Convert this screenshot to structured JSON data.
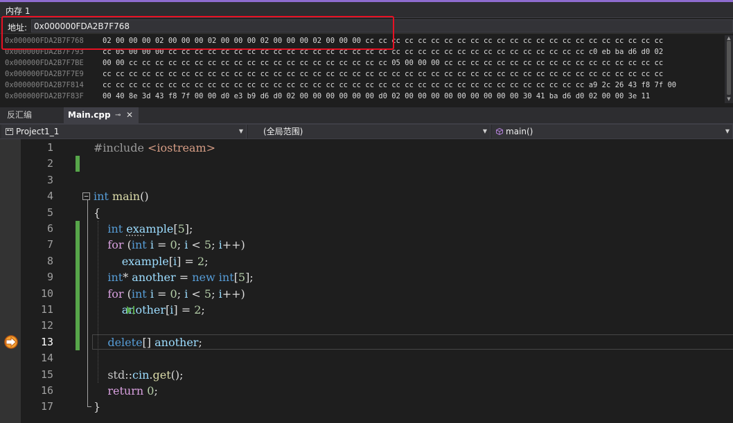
{
  "memory_window": {
    "title": "内存 1",
    "address_label": "地址:",
    "address_value": "0x000000FDA2B7F768",
    "rows": [
      {
        "address": "0x000000FDA2B7F768",
        "bytes": "02 00 00 00 02 00 00 00 02 00 00 00 02 00 00 00 02 00 00 00 cc cc cc cc cc cc cc cc cc cc cc cc cc cc cc cc cc cc cc cc cc cc cc"
      },
      {
        "address": "0x000000FDA2B7F793",
        "bytes": "cc 05 00 00 00 cc cc cc cc cc cc cc cc cc cc cc cc cc cc cc cc cc cc cc cc cc cc cc cc cc cc cc cc cc cc cc cc c0 eb ba d6 d0 02"
      },
      {
        "address": "0x000000FDA2B7F7BE",
        "bytes": "00 00 cc cc cc cc cc cc cc cc cc cc cc cc cc cc cc cc cc cc cc cc 05 00 00 00 cc cc cc cc cc cc cc cc cc cc cc cc cc cc cc cc cc"
      },
      {
        "address": "0x000000FDA2B7F7E9",
        "bytes": "cc cc cc cc cc cc cc cc cc cc cc cc cc cc cc cc cc cc cc cc cc cc cc cc cc cc cc cc cc cc cc cc cc cc cc cc cc cc cc cc cc cc cc"
      },
      {
        "address": "0x000000FDA2B7F814",
        "bytes": "cc cc cc cc cc cc cc cc cc cc cc cc cc cc cc cc cc cc cc cc cc cc cc cc cc cc cc cc cc cc cc cc cc cc cc cc cc a9 2c 26 43 f8 7f 00"
      },
      {
        "address": "0x000000FDA2B7F83F",
        "bytes": "00 40 8e 3d 43 f8 7f 00 00 d0 e3 b9 d6 d0 02 00 00 00 00 00 00 d0 02 00 00 00 00 00 00 00 00 00 30 41 ba d6 d0 02 00 00 3e 11"
      }
    ]
  },
  "tabs": [
    {
      "label": "反汇编"
    },
    {
      "label": "Main.cpp",
      "pin": "⊸",
      "close": "✕"
    }
  ],
  "nav": {
    "project": "Project1_1",
    "scope": "(全局范围)",
    "function": "main()"
  },
  "editor": {
    "current_line": 13,
    "line_numbers": [
      "1",
      "2",
      "3",
      "4",
      "5",
      "6",
      "7",
      "8",
      "9",
      "10",
      "11",
      "12",
      "13",
      "14",
      "15",
      "16",
      "17"
    ],
    "lines": [
      [
        {
          "c": "pre",
          "t": "#include "
        },
        {
          "c": "str",
          "t": "<iostream>"
        }
      ],
      [],
      [],
      [
        {
          "c": "kw",
          "t": "int"
        },
        {
          "c": "pl",
          "t": " "
        },
        {
          "c": "fn",
          "t": "main"
        },
        {
          "c": "pl",
          "t": "()"
        }
      ],
      [
        {
          "c": "pl",
          "t": "{"
        }
      ],
      [
        {
          "c": "pl",
          "t": "    "
        },
        {
          "c": "kw",
          "t": "int"
        },
        {
          "c": "pl",
          "t": " "
        },
        {
          "c": "var dots",
          "t": "exa"
        },
        {
          "c": "var",
          "t": "mple"
        },
        {
          "c": "pl",
          "t": "["
        },
        {
          "c": "num",
          "t": "5"
        },
        {
          "c": "pl",
          "t": "];"
        }
      ],
      [
        {
          "c": "pl",
          "t": "    "
        },
        {
          "c": "ctl",
          "t": "for"
        },
        {
          "c": "pl",
          "t": " ("
        },
        {
          "c": "kw",
          "t": "int"
        },
        {
          "c": "pl",
          "t": " "
        },
        {
          "c": "var",
          "t": "i"
        },
        {
          "c": "pl",
          "t": " = "
        },
        {
          "c": "num",
          "t": "0"
        },
        {
          "c": "pl",
          "t": "; "
        },
        {
          "c": "var",
          "t": "i"
        },
        {
          "c": "pl",
          "t": " < "
        },
        {
          "c": "num",
          "t": "5"
        },
        {
          "c": "pl",
          "t": "; "
        },
        {
          "c": "var",
          "t": "i"
        },
        {
          "c": "pl",
          "t": "++)"
        }
      ],
      [
        {
          "c": "pl",
          "t": "        "
        },
        {
          "c": "var",
          "t": "example"
        },
        {
          "c": "pl",
          "t": "["
        },
        {
          "c": "var",
          "t": "i"
        },
        {
          "c": "pl",
          "t": "] = "
        },
        {
          "c": "num",
          "t": "2"
        },
        {
          "c": "pl",
          "t": ";"
        }
      ],
      [
        {
          "c": "pl",
          "t": "    "
        },
        {
          "c": "kw",
          "t": "int"
        },
        {
          "c": "pl",
          "t": "* "
        },
        {
          "c": "var",
          "t": "another"
        },
        {
          "c": "pl",
          "t": " = "
        },
        {
          "c": "kw",
          "t": "new"
        },
        {
          "c": "pl",
          "t": " "
        },
        {
          "c": "kw",
          "t": "int"
        },
        {
          "c": "pl",
          "t": "["
        },
        {
          "c": "num",
          "t": "5"
        },
        {
          "c": "pl",
          "t": "];"
        }
      ],
      [
        {
          "c": "pl",
          "t": "    "
        },
        {
          "c": "ctl",
          "t": "for"
        },
        {
          "c": "pl",
          "t": " ("
        },
        {
          "c": "kw",
          "t": "int"
        },
        {
          "c": "pl",
          "t": " "
        },
        {
          "c": "var",
          "t": "i"
        },
        {
          "c": "pl",
          "t": " = "
        },
        {
          "c": "num",
          "t": "0"
        },
        {
          "c": "pl",
          "t": "; "
        },
        {
          "c": "var",
          "t": "i"
        },
        {
          "c": "pl",
          "t": " < "
        },
        {
          "c": "num",
          "t": "5"
        },
        {
          "c": "pl",
          "t": "; "
        },
        {
          "c": "var",
          "t": "i"
        },
        {
          "c": "pl",
          "t": "++)"
        }
      ],
      [
        {
          "c": "pl",
          "t": "        "
        },
        {
          "c": "var",
          "t": "another"
        },
        {
          "c": "pl",
          "t": "["
        },
        {
          "c": "var",
          "t": "i"
        },
        {
          "c": "pl",
          "t": "] = "
        },
        {
          "c": "num",
          "t": "2"
        },
        {
          "c": "pl",
          "t": ";"
        }
      ],
      [],
      [
        {
          "c": "pl",
          "t": "    "
        },
        {
          "c": "kw",
          "t": "delete"
        },
        {
          "c": "pl",
          "t": "[] "
        },
        {
          "c": "var",
          "t": "another"
        },
        {
          "c": "pl",
          "t": ";"
        }
      ],
      [],
      [
        {
          "c": "pl",
          "t": "    "
        },
        {
          "c": "ns",
          "t": "std"
        },
        {
          "c": "pl",
          "t": "::"
        },
        {
          "c": "var",
          "t": "cin"
        },
        {
          "c": "pl",
          "t": "."
        },
        {
          "c": "fn",
          "t": "get"
        },
        {
          "c": "pl",
          "t": "();"
        }
      ],
      [
        {
          "c": "pl",
          "t": "    "
        },
        {
          "c": "ctl",
          "t": "return"
        },
        {
          "c": "pl",
          "t": " "
        },
        {
          "c": "num",
          "t": "0"
        },
        {
          "c": "pl",
          "t": ";"
        }
      ],
      [
        {
          "c": "pl",
          "t": "}"
        }
      ]
    ]
  },
  "colors": {
    "highlight_border": "#e81123",
    "change_bar": "#57a64a",
    "keyword": "#569cd6",
    "control_keyword": "#d8a0df",
    "number": "#b5cea8",
    "string": "#d69d85",
    "variable": "#9cdcfe",
    "function": "#dcdcaa",
    "exec_arrow": "#f0a030"
  },
  "icons": {
    "execution_pointer": "execution-arrow-icon",
    "step_marker": "run-to-click-icon",
    "fold_toggle": "collapse-minus-icon",
    "function_symbol": "cube-icon",
    "project_symbol": "project-icon"
  }
}
